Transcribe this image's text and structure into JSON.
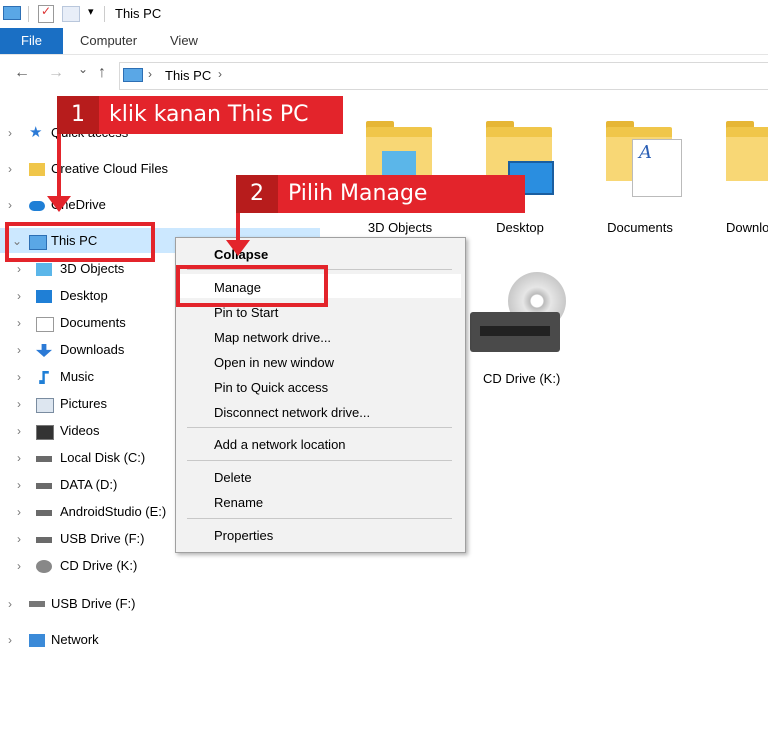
{
  "titlebar": {
    "title": "This PC",
    "dropdown_glyph": "▾"
  },
  "ribbon": {
    "tabs": [
      {
        "label": "File"
      },
      {
        "label": "Computer"
      },
      {
        "label": "View"
      }
    ]
  },
  "nav": {
    "back": "←",
    "forward": "→",
    "recent": "⌄",
    "up": "↑",
    "address": {
      "chev": "›",
      "location": "This PC"
    }
  },
  "sidebar": {
    "quick_access": "Quick access",
    "creative_cloud": "Creative Cloud Files",
    "onedrive": "OneDrive",
    "this_pc": "This PC",
    "children": [
      {
        "label": "3D Objects",
        "icon": "cube-icon"
      },
      {
        "label": "Desktop",
        "icon": "desktop-icon"
      },
      {
        "label": "Documents",
        "icon": "document-icon"
      },
      {
        "label": "Downloads",
        "icon": "download-icon"
      },
      {
        "label": "Music",
        "icon": "music-icon"
      },
      {
        "label": "Pictures",
        "icon": "picture-icon"
      },
      {
        "label": "Videos",
        "icon": "video-icon"
      },
      {
        "label": "Local Disk (C:)",
        "icon": "drive-icon"
      },
      {
        "label": "DATA (D:)",
        "icon": "drive-icon"
      },
      {
        "label": "AndroidStudio (E:)",
        "icon": "drive-icon"
      },
      {
        "label": "USB Drive (F:)",
        "icon": "usb-drive-icon"
      },
      {
        "label": "CD Drive (K:)",
        "icon": "cd-drive-icon"
      }
    ],
    "usb_drive": "USB Drive (F:)",
    "network": "Network"
  },
  "content": {
    "folders": [
      {
        "label": "3D Objects"
      },
      {
        "label": "Desktop"
      },
      {
        "label": "Documents"
      },
      {
        "label": "Downlo"
      }
    ],
    "drive": {
      "label": "CD Drive (K:)"
    }
  },
  "context_menu": {
    "collapse": "Collapse",
    "manage": "Manage",
    "pin_start": "Pin to Start",
    "map_drive": "Map network drive...",
    "open_new": "Open in new window",
    "pin_quick": "Pin to Quick access",
    "disconnect": "Disconnect network drive...",
    "add_location": "Add a network location",
    "delete": "Delete",
    "rename": "Rename",
    "properties": "Properties"
  },
  "annotations": {
    "step1": {
      "num": "1",
      "text": "klik kanan This PC"
    },
    "step2": {
      "num": "2",
      "text": "Pilih Manage"
    },
    "accent_color": "#e3242b"
  },
  "colors": {
    "file_tab": "#1a6fc4",
    "selection": "#cce8ff",
    "folder": "#f0c64a"
  }
}
